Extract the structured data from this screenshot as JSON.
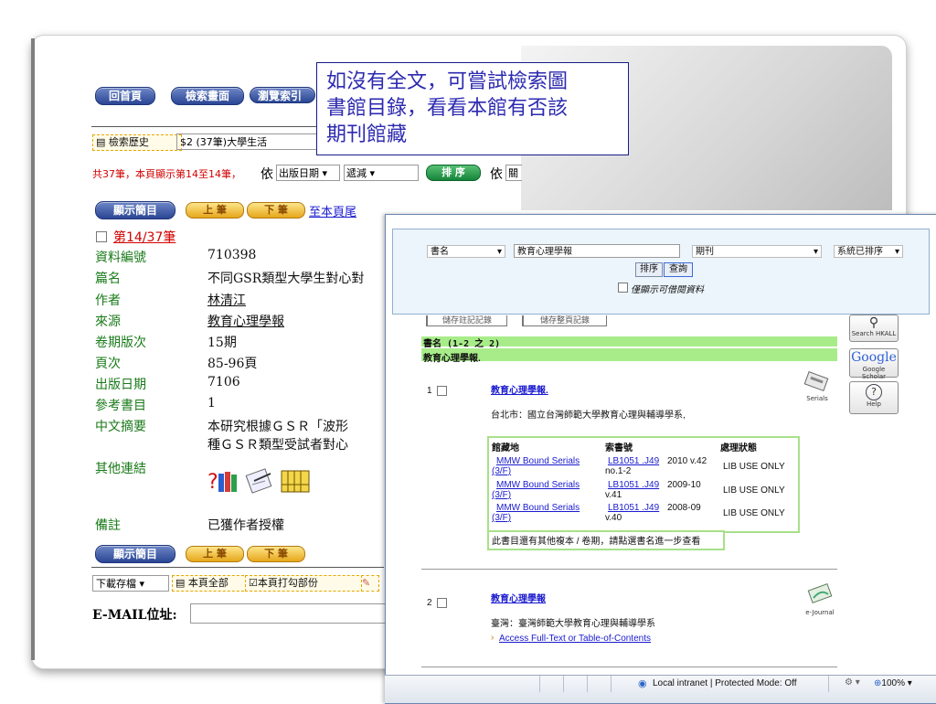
{
  "callout": {
    "line1": "如沒有全文，可嘗試檢索圖",
    "line2": "書館目錄，看看本館有否該",
    "line3": "期刊館藏"
  },
  "left": {
    "nav": {
      "home": "回首頁",
      "search": "檢索畫面",
      "browse": "瀏覽索引"
    },
    "history_btn": "檢索歷史",
    "history_value": "$2 (37筆)大學生活",
    "result_info": "共37筆，本頁顯示第14至14筆，",
    "sort_by_prefix": "依",
    "sort_field": "出版日期",
    "sort_order": "遞減",
    "sort_btn": "排 序",
    "sort_by_prefix2": "依",
    "sort_field2_partial": "關",
    "show_brief": "顯示簡目",
    "prev": "上 筆",
    "next": "下 筆",
    "to_bottom": "至本頁尾",
    "record_no": "第14/37筆",
    "fields": [
      {
        "label": "資料編號",
        "value": "710398"
      },
      {
        "label": "篇名",
        "value": "不同GSR類型大學生對心對"
      },
      {
        "label": "作者",
        "value": "林清江"
      },
      {
        "label": "來源",
        "value": "教育心理學報"
      },
      {
        "label": "卷期版次",
        "value": "15期"
      },
      {
        "label": "頁次",
        "value": "85-96頁"
      },
      {
        "label": "出版日期",
        "value": "7106"
      },
      {
        "label": "參考書目",
        "value": "1"
      },
      {
        "label": "中文摘要",
        "value": "本研究根據ＧＳＲ「波形",
        "value2": "種ＧＳＲ類型受試者對心"
      },
      {
        "label": "其他連結",
        "value": ""
      },
      {
        "label": "備註",
        "value": "已獲作者授權"
      }
    ],
    "download_select": "下載存檔",
    "this_page_all": "本頁全部",
    "this_page_checked": "本頁打勾部份",
    "email_label": "E-MAIL位址:"
  },
  "win": {
    "field_select": "書名",
    "query": "教育心理學報",
    "type_select": "期刊",
    "sort_select": "系統已排序",
    "sort_btn": "排序",
    "search_btn": "查詢",
    "available_only": "僅顯示可借閱資料",
    "save_marked": "儲存註記記錄",
    "save_page": "儲存整頁記錄",
    "range": "書名 (1-2 之 2)",
    "heading": "教育心理學報.",
    "side": {
      "search_hkall": "Search HKALL",
      "google": "Google",
      "scholar": "Google Scholar",
      "help": "Help"
    },
    "results": [
      {
        "no": "1",
        "title": "教育心理學報.",
        "pub": "台北市：國立台灣師範大學教育心理與輔導學系,",
        "badge": "Serials"
      },
      {
        "no": "2",
        "title": "教育心理學報",
        "pub": "臺灣：臺灣師範大學教育心理與輔導學系",
        "badge": "e-Journal",
        "access": "Access Full-Text or Table-of-Contents"
      }
    ],
    "holdings_head": {
      "loc": "館藏地",
      "call": "索書號",
      "status": "處理狀態"
    },
    "holdings": [
      {
        "loc": "MMW Bound Serials",
        "loc2": "(3/F)",
        "call": "LB1051 .J49",
        "vol": "2010 v.42",
        "vol2": "no.1-2",
        "status": "LIB USE ONLY"
      },
      {
        "loc": "MMW Bound Serials",
        "loc2": "(3/F)",
        "call": "LB1051 .J49",
        "vol": "2009-10",
        "vol2": "v.41",
        "status": "LIB USE ONLY"
      },
      {
        "loc": "MMW Bound Serials",
        "loc2": "(3/F)",
        "call": "LB1051 .J49",
        "vol": "2008-09",
        "vol2": "v.40",
        "status": "LIB USE ONLY"
      }
    ],
    "more_note": "此書目還有其他複本 / 卷期，請點選書名進一步查看",
    "status": {
      "zone": "Local intranet | Protected Mode: Off",
      "zoom": "100%"
    }
  }
}
